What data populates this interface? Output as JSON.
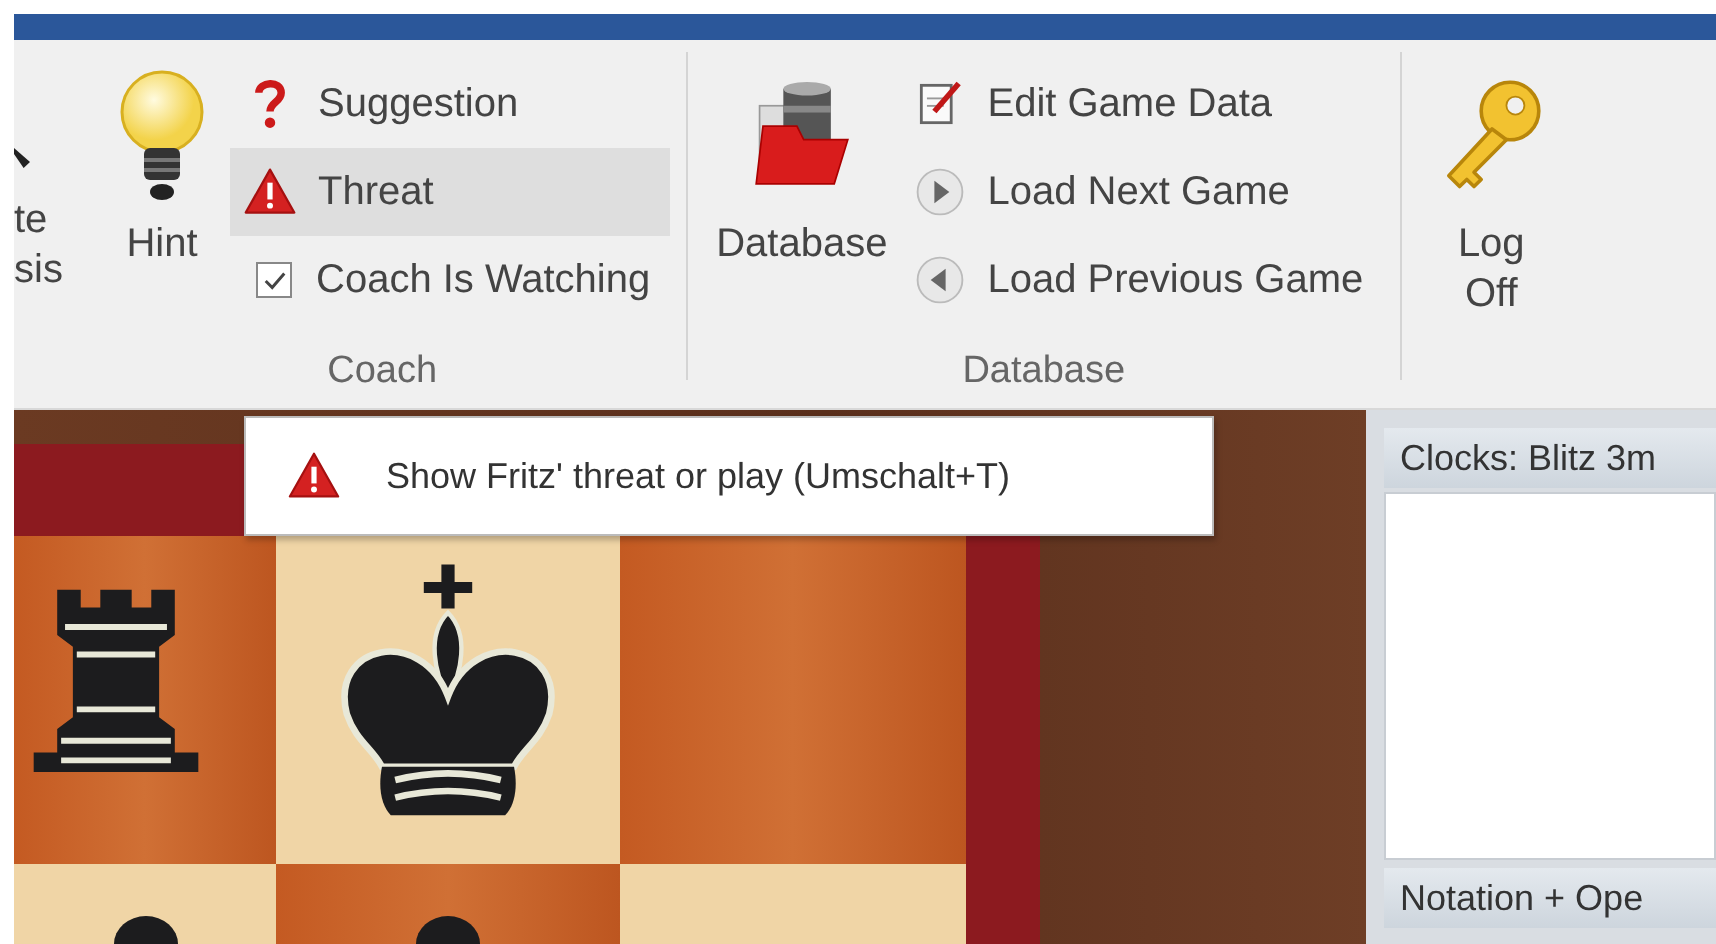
{
  "ribbon": {
    "cut_off_button": {
      "label_lines": [
        "te",
        "sis"
      ]
    },
    "groups": [
      {
        "title": "Coach",
        "large_buttons": [
          {
            "label": "Hint"
          }
        ],
        "small_items": [
          {
            "kind": "button",
            "label": "Suggestion",
            "highlighted": false
          },
          {
            "kind": "button",
            "label": "Threat",
            "highlighted": true
          },
          {
            "kind": "checkbox",
            "label": "Coach Is Watching",
            "checked": true
          }
        ]
      },
      {
        "title": "Database",
        "large_buttons": [
          {
            "label": "Database"
          }
        ],
        "small_items": [
          {
            "kind": "button",
            "label": "Edit Game Data",
            "highlighted": false
          },
          {
            "kind": "button",
            "label": "Load Next Game",
            "highlighted": false
          },
          {
            "kind": "button",
            "label": "Load Previous Game",
            "highlighted": false
          }
        ]
      }
    ],
    "trailing_buttons": [
      {
        "label_lines": [
          "Log",
          "Off"
        ]
      }
    ]
  },
  "tooltip": {
    "text": "Show Fritz' threat or play (Umschalt+T)"
  },
  "side_panels": [
    {
      "title": "Clocks: Blitz 3m"
    },
    {
      "title": "Notation + Ope"
    }
  ]
}
